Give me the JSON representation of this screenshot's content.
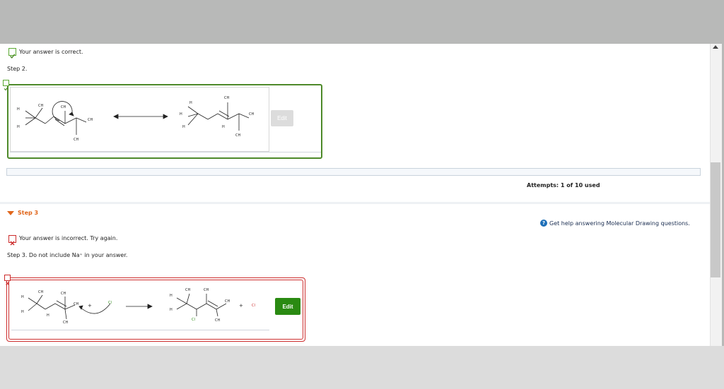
{
  "step2": {
    "status": "Your answer is correct.",
    "label": "Step 2.",
    "edit_label": "Edit"
  },
  "attempts": "Attempts: 1 of 10 used",
  "step3": {
    "header": "Step 3",
    "help_link": "Get help answering Molecular Drawing questions.",
    "status": "Your answer is incorrect.  Try again.",
    "instruction": "Step 3. Do not include Na⁺ in your answer.",
    "edit_label": "Edit"
  },
  "chem": {
    "ch3": "CH",
    "sub3": "3",
    "h3c": "H",
    "h": "H",
    "plus": "+",
    "cl": "Cl"
  },
  "colors": {
    "correct": "#4e8a2a",
    "incorrect": "#cc2b2b",
    "accent": "#e0661b",
    "edit_button": "#2a8a12"
  },
  "icons": [
    "check-icon",
    "x-icon",
    "help-icon",
    "triangle-down-icon",
    "scroll-up-icon"
  ]
}
